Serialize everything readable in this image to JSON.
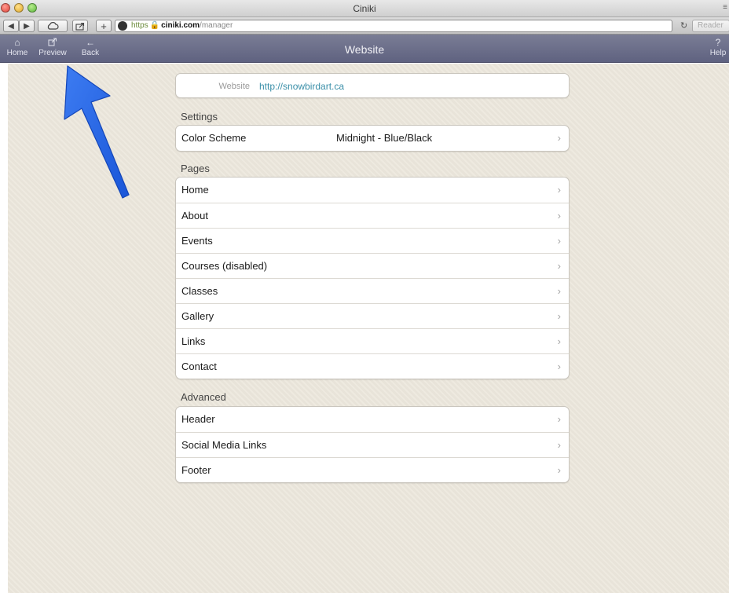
{
  "window": {
    "title": "Ciniki",
    "address": {
      "scheme": "https",
      "domain": "ciniki.com",
      "path": "/manager"
    },
    "reader_label": "Reader"
  },
  "appbar": {
    "title": "Website",
    "home_label": "Home",
    "preview_label": "Preview",
    "back_label": "Back",
    "help_label": "Help",
    "help_glyph": "?"
  },
  "website": {
    "label": "Website",
    "url": "http://snowbirdart.ca"
  },
  "settings": {
    "title": "Settings",
    "items": [
      {
        "label": "Color Scheme",
        "value": "Midnight - Blue/Black"
      }
    ]
  },
  "pages": {
    "title": "Pages",
    "items": [
      {
        "label": "Home"
      },
      {
        "label": "About"
      },
      {
        "label": "Events"
      },
      {
        "label": "Courses (disabled)"
      },
      {
        "label": "Classes"
      },
      {
        "label": "Gallery"
      },
      {
        "label": "Links"
      },
      {
        "label": "Contact"
      }
    ]
  },
  "advanced": {
    "title": "Advanced",
    "items": [
      {
        "label": "Header"
      },
      {
        "label": "Social Media Links"
      },
      {
        "label": "Footer"
      }
    ]
  },
  "colors": {
    "appbar": "#6b6e89",
    "link": "#3a8fa8",
    "arrow": "#1f63e8",
    "page_bg": "#ece7dc"
  },
  "icons": [
    "home-icon",
    "external-link-icon",
    "back-arrow-icon",
    "help-icon",
    "chevron-right-icon",
    "globe-icon",
    "lock-icon",
    "reload-icon"
  ]
}
